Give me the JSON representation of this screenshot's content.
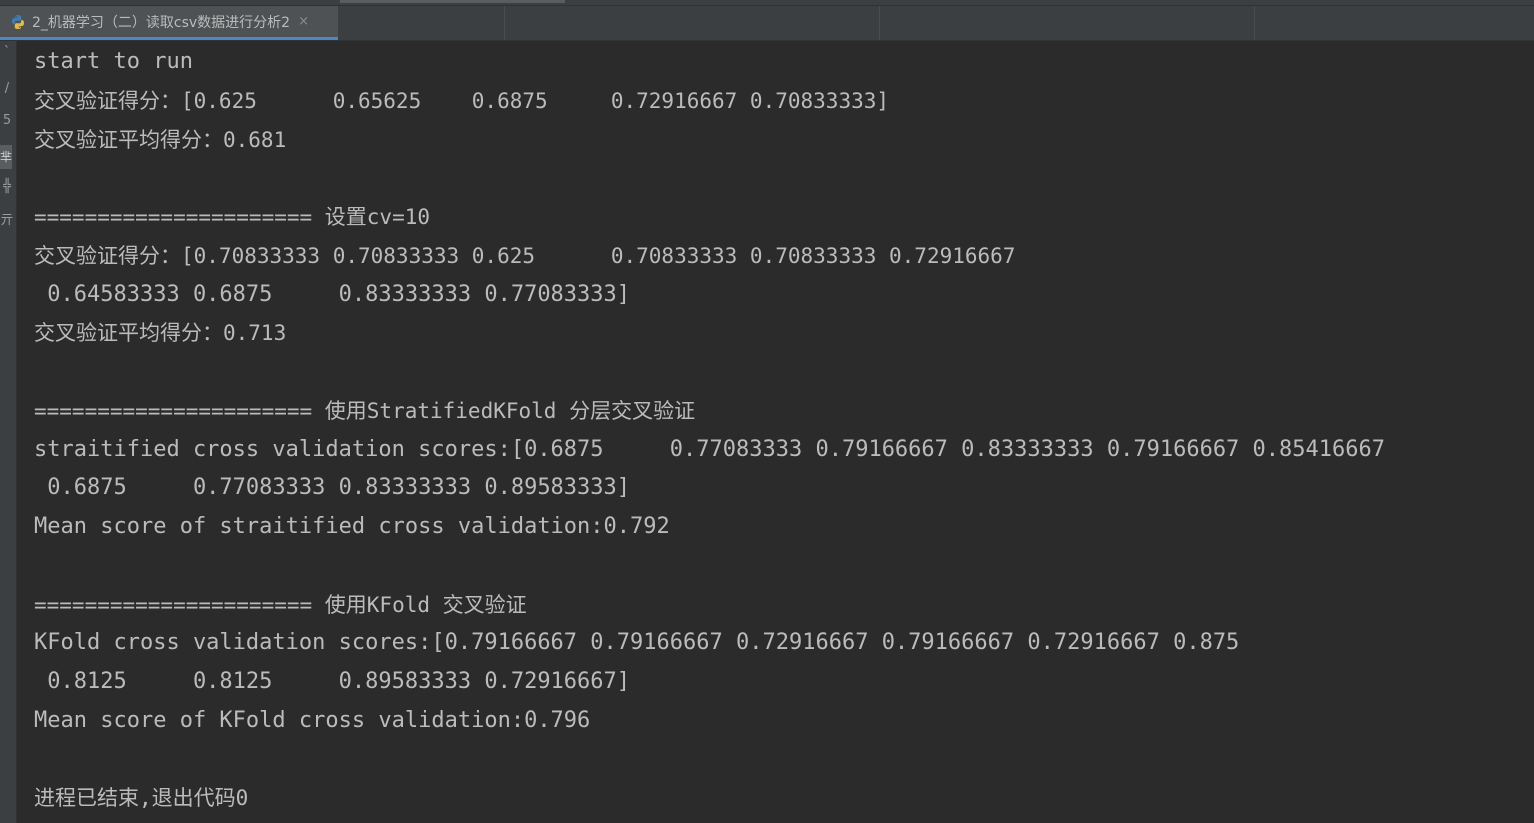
{
  "tab": {
    "title": "2_机器学习（二）读取csv数据进行分析2",
    "close_glyph": "×"
  },
  "gutter": [
    "`",
    "/",
    "5",
    "芈",
    "╬",
    "亓"
  ],
  "console": {
    "lines": [
      "start to run",
      "交叉验证得分：[0.625      0.65625    0.6875     0.72916667 0.70833333]",
      "交叉验证平均得分：0.681",
      "",
      "====================== 设置cv=10",
      "交叉验证得分：[0.70833333 0.70833333 0.625      0.70833333 0.70833333 0.72916667",
      " 0.64583333 0.6875     0.83333333 0.77083333]",
      "交叉验证平均得分：0.713",
      "",
      "====================== 使用StratifiedKFold 分层交叉验证",
      "straitified cross validation scores:[0.6875     0.77083333 0.79166667 0.83333333 0.79166667 0.85416667",
      " 0.6875     0.77083333 0.83333333 0.89583333]",
      "Mean score of straitified cross validation:0.792",
      "",
      "====================== 使用KFold 交叉验证",
      "KFold cross validation scores:[0.79166667 0.79166667 0.72916667 0.79166667 0.72916667 0.875",
      " 0.8125     0.8125     0.89583333 0.72916667]",
      "Mean score of KFold cross validation:0.796",
      "",
      "进程已结束,退出代码0"
    ]
  }
}
